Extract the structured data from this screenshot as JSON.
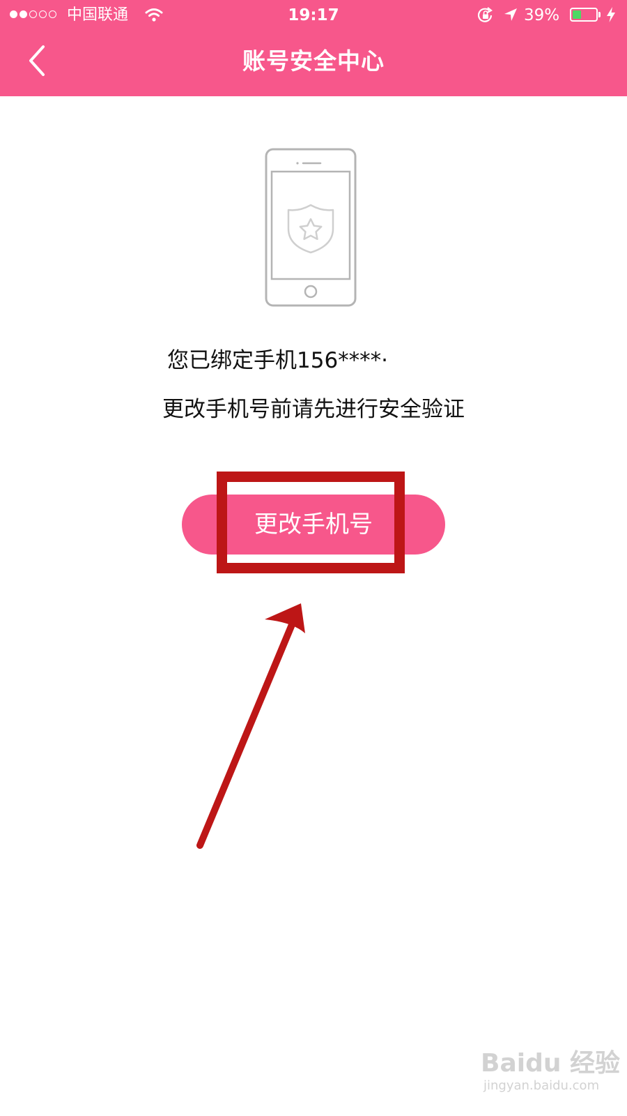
{
  "status_bar": {
    "carrier": "中国联通",
    "time": "19:17",
    "battery": "39%",
    "battery_level": 0.39
  },
  "nav": {
    "title": "账号安全中心",
    "back_icon": "chevron-left-icon"
  },
  "main": {
    "illustration_icon": "phone-shield-icon",
    "bind_text": "您已绑定手机156****·",
    "verify_text": "更改手机号前请先进行安全验证",
    "change_button_label": "更改手机号"
  },
  "watermark": {
    "brand": "Baidu 经验",
    "url": "jingyan.baidu.com"
  },
  "colors": {
    "brand_pink": "#f7578b",
    "annotation_red": "#bd1616",
    "battery_green": "#4cd964"
  }
}
